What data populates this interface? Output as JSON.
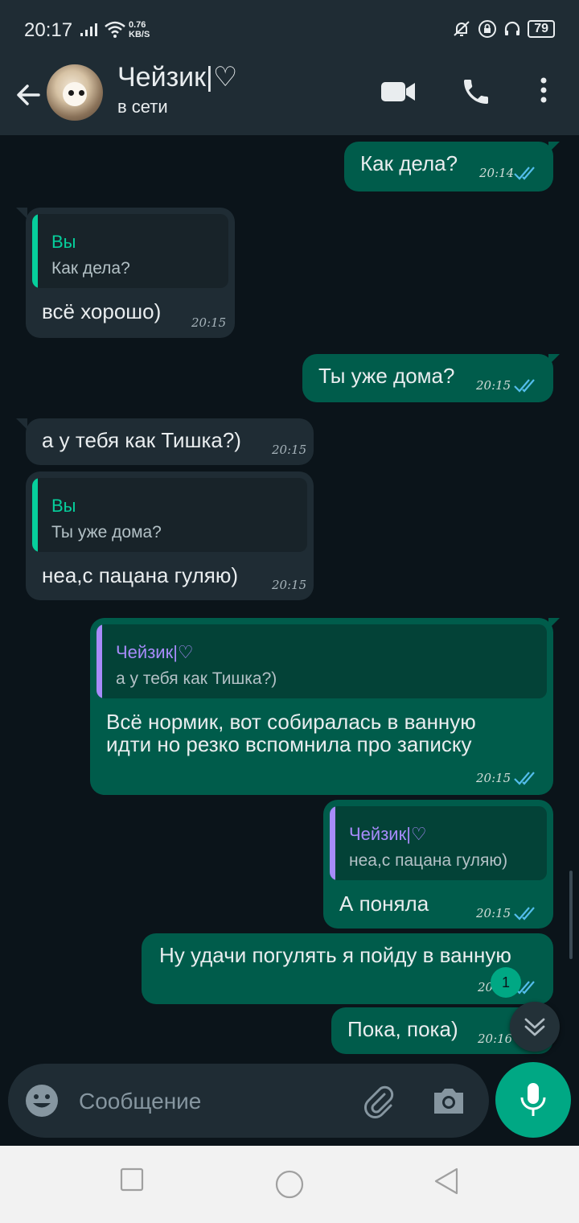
{
  "status_bar": {
    "time": "20:17",
    "net_speed_value": "0.76",
    "net_speed_unit": "KB/S",
    "battery": "79"
  },
  "header": {
    "contact_name": "Чейзик|♡",
    "contact_status": "в сети"
  },
  "icons": {
    "back": "arrow-left-icon",
    "video": "video-camera-icon",
    "call": "phone-icon",
    "menu": "more-vertical-icon",
    "emoji": "emoji-icon",
    "attach": "paperclip-icon",
    "camera": "camera-icon",
    "mic": "microphone-icon",
    "scroll": "chevrons-down-icon",
    "read": "double-check-icon"
  },
  "colors": {
    "outgoing_bubble": "#005c4b",
    "incoming_bubble": "#1f2c34",
    "background": "#0b141a",
    "accent": "#00a884",
    "read_ticks": "#53bdeb",
    "quote_you": "#06cf9c",
    "quote_contact": "#a78bfa"
  },
  "messages": [
    {
      "text": "Как дела?",
      "time": "20:14"
    },
    {
      "quote_author": "Вы",
      "quote_text": "Как дела?",
      "text": "всё хорошо)",
      "time": "20:15"
    },
    {
      "text": "Ты уже дома?",
      "time": "20:15"
    },
    {
      "text": "а у тебя как Тишка?)",
      "time": "20:15"
    },
    {
      "quote_author": "Вы",
      "quote_text": "Ты уже дома?",
      "text": "неа,с пацана гуляю)",
      "time": "20:15"
    },
    {
      "quote_author": "Чейзик|♡",
      "quote_text": "а у тебя как Тишка?)",
      "text_line1": "Всё нормик, вот собиралась в ванную",
      "text_line2": "идти но резко вспомнила про записку",
      "time": "20:15"
    },
    {
      "quote_author": "Чейзик|♡",
      "quote_text": "неа,с пацана гуляю)",
      "text": "А поняла",
      "time": "20:15"
    },
    {
      "text": "Ну удачи погулять я пойду в ванную",
      "time": "20:16"
    },
    {
      "text": "Пока, пока)",
      "time": "20:16"
    }
  ],
  "unread_badge": "1",
  "composer": {
    "placeholder": "Сообщение"
  }
}
